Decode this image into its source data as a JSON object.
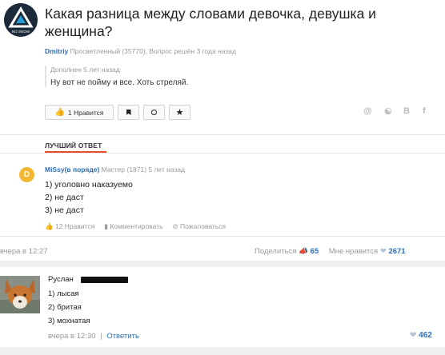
{
  "question": {
    "avatar_text": "NO SNOW",
    "title": "Какая разница между словами девочка, девушка и женщина?",
    "author_nick": "Dmitriy",
    "author_meta": "Просветленный (35770), Вопрос решён 3 года назад",
    "update_label": "Дополнен 5 лет назад",
    "update_text": "Ну вот не пойму и все. Хоть стреляй.",
    "like_button_label": "1 Нравится",
    "share_labels": [
      "@",
      "ok",
      "B",
      "f"
    ]
  },
  "best_answer": {
    "section_label": "ЛУЧШИЙ ОТВЕТ",
    "accent_color": "#e94b26",
    "avatar_letter": "D",
    "avatar_color": "#f2b632",
    "author_nick": "MiSsy(в порядe)",
    "author_meta": "Мастер (1871) 5 лет назад",
    "lines": [
      "1) уголовно наказуемо",
      "2) не даст",
      "3) не даст"
    ],
    "likes_label": "12 Нравится",
    "comment_label": "Комментировать",
    "complain_label": "Пожаловаться"
  },
  "post_footer": {
    "time": "вчера в 12:27",
    "share_label": "Поделиться",
    "share_count": "65",
    "like_label": "Мне нравится",
    "like_count": "2671"
  },
  "comment": {
    "author": "Руслан",
    "lines": [
      "1) лысая",
      "2) бритая",
      "3) мохнатая"
    ],
    "time": "вчера в 12:30",
    "separator": "|",
    "reply_label": "Ответить",
    "likes": "462"
  },
  "colors": {
    "link": "#2c6fb6",
    "muted": "#999999",
    "heart": "#b5c3d3"
  }
}
